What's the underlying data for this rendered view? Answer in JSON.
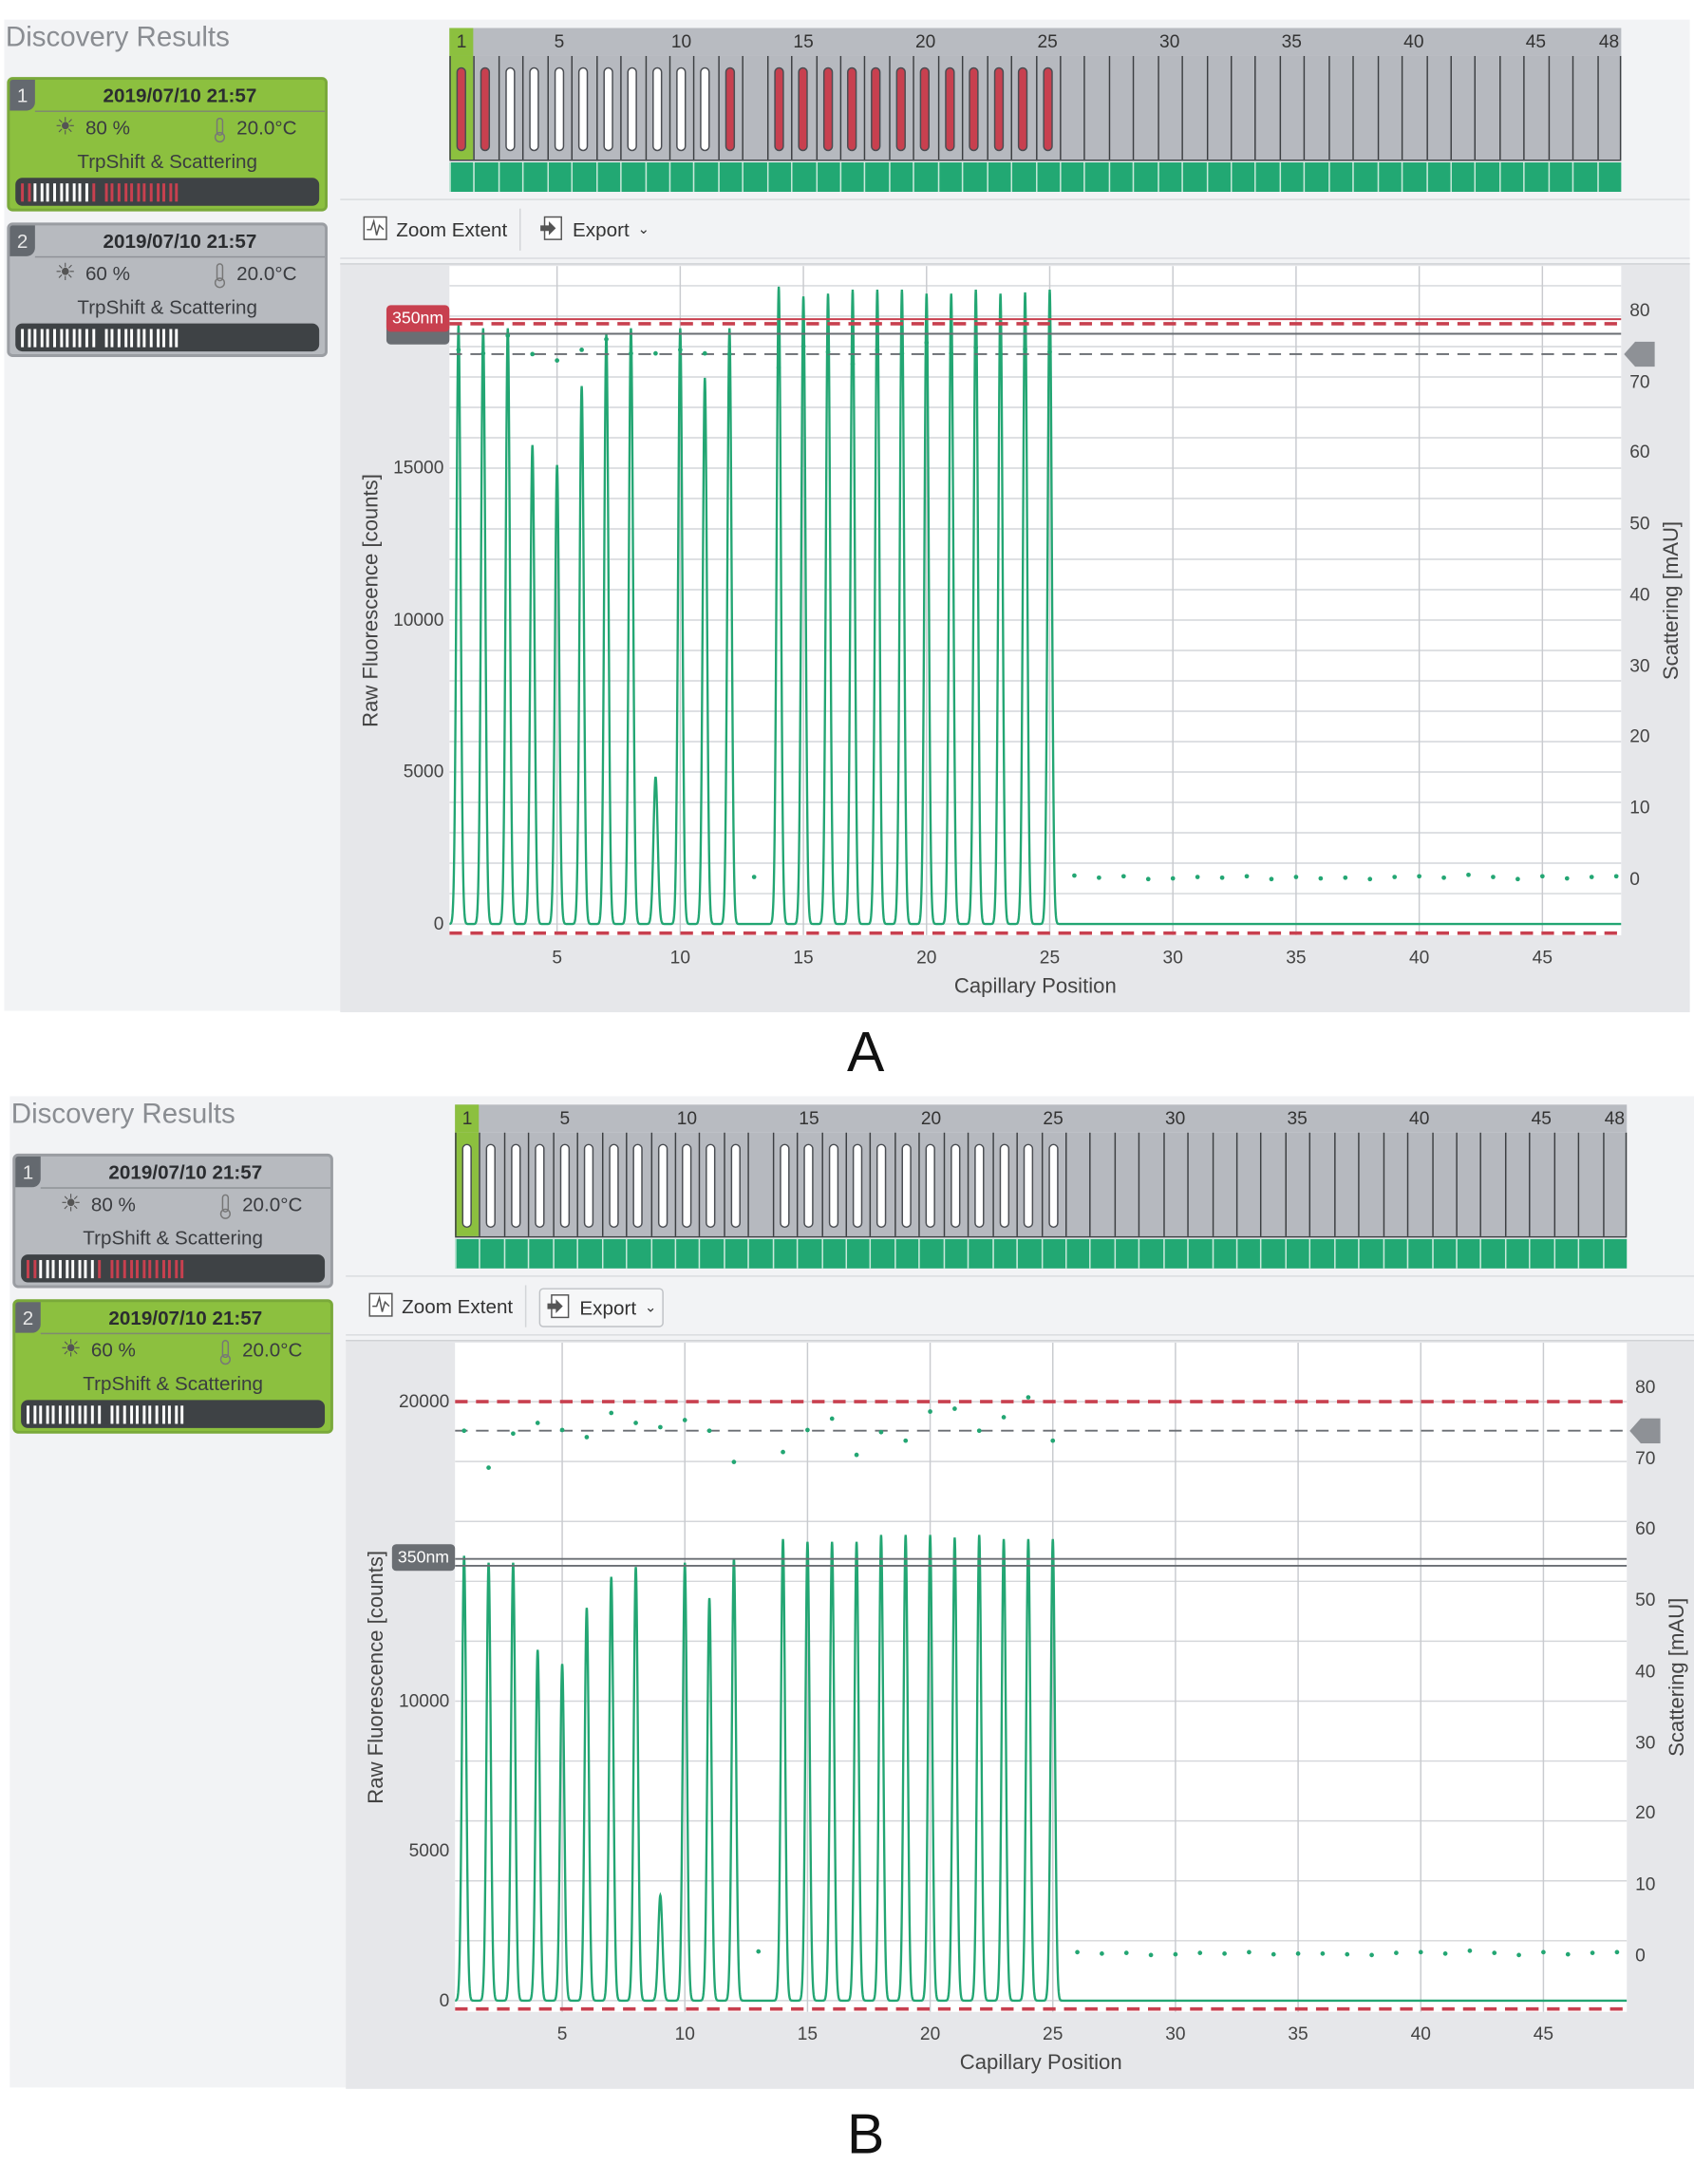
{
  "app_title": "Discovery Results",
  "panels": [
    {
      "label": "A",
      "selected_run": 0,
      "toolbar": {
        "zoom_extent": "Zoom Extent",
        "export": "Export"
      },
      "wavelength_label": "350nm",
      "wavelength_label_color": "#c8404f"
    },
    {
      "label": "B",
      "selected_run": 1,
      "toolbar": {
        "zoom_extent": "Zoom Extent",
        "export": "Export"
      },
      "wavelength_label": "350nm",
      "wavelength_label_color": "#6a6e73"
    }
  ],
  "runs": [
    {
      "index": "1",
      "datetime": "2019/07/10 21:57",
      "excitation": "80 %",
      "temperature": "20.0°C",
      "method": "TrpShift & Scattering",
      "capillary_status": [
        "red",
        "red",
        "white",
        "white",
        "white",
        "white",
        "white",
        "white",
        "white",
        "white",
        "white",
        "red",
        "empty",
        "red",
        "red",
        "red",
        "red",
        "red",
        "red",
        "red",
        "red",
        "red",
        "red",
        "red",
        "red",
        "none",
        "none",
        "none",
        "none",
        "none",
        "none",
        "none",
        "none",
        "none",
        "none",
        "none",
        "none",
        "none",
        "none",
        "none",
        "none",
        "none",
        "none",
        "none",
        "none",
        "none",
        "none",
        "none"
      ]
    },
    {
      "index": "2",
      "datetime": "2019/07/10 21:57",
      "excitation": "60 %",
      "temperature": "20.0°C",
      "method": "TrpShift & Scattering",
      "capillary_status": [
        "white",
        "white",
        "white",
        "white",
        "white",
        "white",
        "white",
        "white",
        "white",
        "white",
        "white",
        "white",
        "empty",
        "white",
        "white",
        "white",
        "white",
        "white",
        "white",
        "white",
        "white",
        "white",
        "white",
        "white",
        "white",
        "none",
        "none",
        "none",
        "none",
        "none",
        "none",
        "none",
        "none",
        "none",
        "none",
        "none",
        "none",
        "none",
        "none",
        "none",
        "none",
        "none",
        "none",
        "none",
        "none",
        "none",
        "none",
        "none"
      ]
    }
  ],
  "capillary_header_labels": [
    "1",
    "5",
    "10",
    "15",
    "20",
    "25",
    "30",
    "35",
    "40",
    "45",
    "48"
  ],
  "colors": {
    "accent_green": "#8cc03f",
    "trace": "#23a673",
    "threshold_red": "#c8404f",
    "capillary_red": "#c8404f"
  },
  "chart_data": [
    {
      "type": "line",
      "title": "",
      "xlabel": "Capillary Position",
      "ylabel": "Raw Fluorescence [counts]",
      "y2label": "Scattering [mAU]",
      "xlim": [
        0.63,
        48.2
      ],
      "ylim": [
        -370,
        21650
      ],
      "y2lim": [
        -7.9,
        86.3
      ],
      "y_grid_step": 1000,
      "xticks": [
        5,
        10,
        15,
        20,
        25,
        30,
        35,
        40,
        45
      ],
      "yticks": [
        0,
        5000,
        10000,
        15000
      ],
      "y2ticks": [
        0,
        10,
        20,
        30,
        40,
        50,
        60,
        70,
        80
      ],
      "fluorescence_peaks": [
        19700,
        19600,
        19600,
        15760,
        15100,
        17700,
        19400,
        19600,
        4840,
        19600,
        17970,
        19600,
        null,
        20970,
        20650,
        20740,
        20870,
        20870,
        20870,
        20740,
        20740,
        20870,
        20740,
        20780,
        20870
      ],
      "scattering": [
        74.5,
        74,
        76.5,
        73.9,
        73,
        74.5,
        76,
        74,
        74,
        74.5,
        74,
        73.9,
        0.3,
        72,
        75,
        74.2,
        72.5,
        74.5,
        74,
        75.5,
        74,
        74.8,
        73.9,
        74.6,
        74.2,
        0.5,
        0.2,
        0.4,
        0,
        0.1,
        0.3,
        0.2,
        0.4,
        0,
        0.3,
        0.1,
        0.2,
        0,
        0.3,
        0.4,
        0.2,
        0.6,
        0.3,
        0,
        0.4,
        0.1,
        0.3,
        0.4
      ],
      "reference_lines": [
        {
          "axis": "left",
          "value": 19900,
          "color": "#c8404f",
          "style": "solid"
        },
        {
          "axis": "left",
          "value": 19750,
          "color": "#c8404f",
          "style": "dashed"
        },
        {
          "axis": "left",
          "value": 19420,
          "color": "#6a6e73",
          "style": "solid"
        },
        {
          "axis": "right",
          "value": 73.9,
          "color": "#6a6e73",
          "style": "dashed"
        },
        {
          "axis": "left",
          "value": -300,
          "color": "#c8404f",
          "style": "dashed"
        }
      ]
    },
    {
      "type": "line",
      "title": "",
      "xlabel": "Capillary Position",
      "ylabel": "Raw Fluorescence [counts]",
      "y2label": "Scattering [mAU]",
      "xlim": [
        0.63,
        48.4
      ],
      "ylim": [
        -375,
        21970
      ],
      "y2lim": [
        -7.9,
        86.3
      ],
      "y_grid_step": 2000,
      "xticks": [
        5,
        10,
        15,
        20,
        25,
        30,
        35,
        40,
        45
      ],
      "yticks": [
        0,
        5000,
        10000,
        20000
      ],
      "y2ticks": [
        0,
        10,
        20,
        30,
        40,
        50,
        60,
        70,
        80
      ],
      "fluorescence_peaks": [
        14850,
        14620,
        14620,
        11710,
        11240,
        13115,
        14150,
        14480,
        3510,
        14620,
        13440,
        14760,
        null,
        15410,
        15320,
        15320,
        15320,
        15550,
        15550,
        15550,
        15460,
        15550,
        15410,
        15410,
        15410
      ],
      "scattering": [
        73.9,
        68.7,
        73.5,
        75,
        74,
        73,
        76.4,
        75,
        74.4,
        75.4,
        73.9,
        69.5,
        0.6,
        70.9,
        74,
        75.6,
        70.5,
        73.7,
        72.5,
        76.6,
        77,
        73.9,
        75.8,
        78.6,
        72.5,
        0.5,
        0.3,
        0.4,
        0.1,
        0.2,
        0.4,
        0.3,
        0.5,
        0.2,
        0.3,
        0.3,
        0.2,
        0.1,
        0.4,
        0.5,
        0.3,
        0.7,
        0.4,
        0.1,
        0.5,
        0.2,
        0.4,
        0.5
      ],
      "reference_lines": [
        {
          "axis": "left",
          "value": 20000,
          "color": "#c8404f",
          "style": "dashed"
        },
        {
          "axis": "left",
          "value": 14750,
          "color": "#6a6e73",
          "style": "solid"
        },
        {
          "axis": "left",
          "value": 14520,
          "color": "#6a6e73",
          "style": "solid"
        },
        {
          "axis": "right",
          "value": 73.9,
          "color": "#6a6e73",
          "style": "dashed"
        },
        {
          "axis": "left",
          "value": -280,
          "color": "#c8404f",
          "style": "dashed"
        }
      ]
    }
  ]
}
